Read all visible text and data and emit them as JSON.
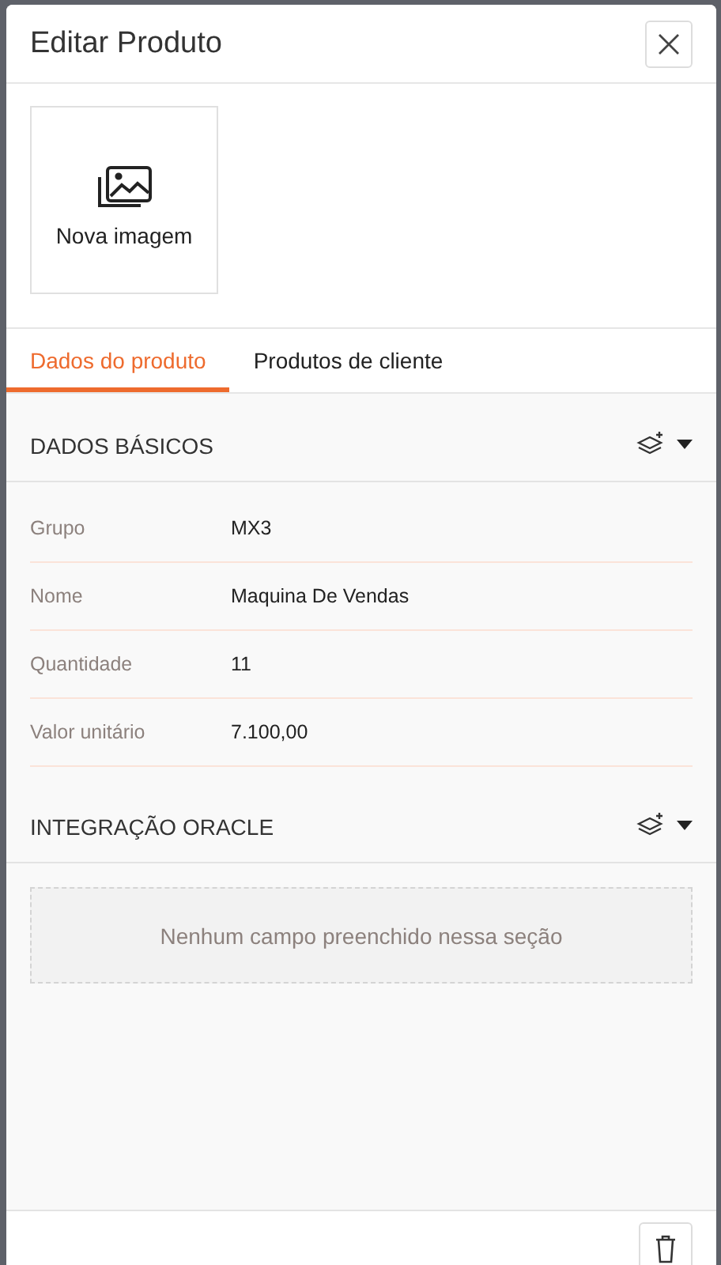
{
  "dialog": {
    "title": "Editar Produto",
    "image_button": {
      "label": "Nova imagem"
    }
  },
  "tabs": [
    {
      "label": "Dados do produto",
      "selected": true
    },
    {
      "label": "Produtos de cliente",
      "selected": false
    }
  ],
  "sections": [
    {
      "title": "DADOS BÁSICOS",
      "fields": [
        {
          "label": "Grupo",
          "value": "MX3"
        },
        {
          "label": "Nome",
          "value": "Maquina De Vendas"
        },
        {
          "label": "Quantidade",
          "value": "11"
        },
        {
          "label": "Valor unitário",
          "value": "7.100,00"
        }
      ]
    },
    {
      "title": "INTEGRAÇÃO ORACLE",
      "empty_message": "Nenhum campo preenchido nessa seção"
    }
  ]
}
